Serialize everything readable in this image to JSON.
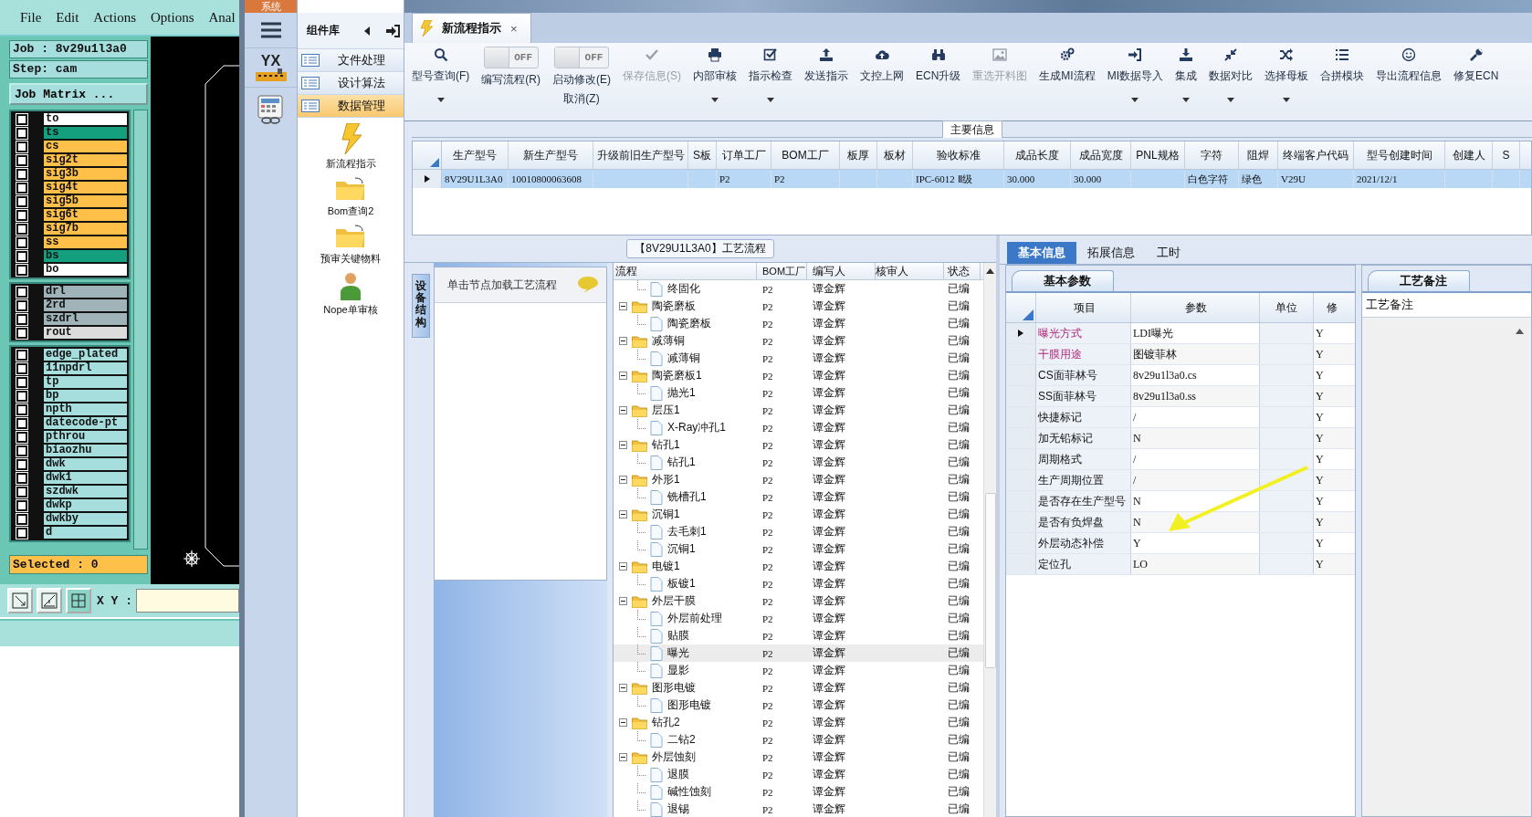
{
  "cam": {
    "menu": [
      "File",
      "Edit",
      "Actions",
      "Options",
      "Anal"
    ],
    "job": "Job : 8v29u1l3a0",
    "step": "Step: cam",
    "matrix_button": "Job Matrix ...",
    "layer_groups": [
      {
        "layers": [
          {
            "name": "to",
            "color": "#ffffff",
            "checked": false
          },
          {
            "name": "ts",
            "color": "#14a07e",
            "checked": false
          },
          {
            "name": "cs",
            "color": "#ffc04a",
            "checked": false
          },
          {
            "name": "sig2t",
            "color": "#ffc04a",
            "checked": false
          },
          {
            "name": "sig3b",
            "color": "#ffc04a",
            "checked": false
          },
          {
            "name": "sig4t",
            "color": "#ffc04a",
            "checked": false
          },
          {
            "name": "sig5b",
            "color": "#ffc04a",
            "checked": false
          },
          {
            "name": "sig6t",
            "color": "#ffc04a",
            "checked": false
          },
          {
            "name": "sig7b",
            "color": "#ffc04a",
            "checked": false
          },
          {
            "name": "ss",
            "color": "#ffc04a",
            "checked": false
          },
          {
            "name": "bs",
            "color": "#14a07e",
            "checked": false
          },
          {
            "name": "bo",
            "color": "#ffffff",
            "checked": false
          }
        ]
      },
      {
        "layers": [
          {
            "name": "drl",
            "color": "#9fb3b8",
            "checked": false
          },
          {
            "name": "2rd",
            "color": "#9fb3b8",
            "checked": false
          },
          {
            "name": "szdrl",
            "color": "#9fb3b8",
            "checked": false
          },
          {
            "name": "rout",
            "color": "#dcdcdc",
            "checked": false
          }
        ]
      },
      {
        "layers": [
          {
            "name": "edge_plated",
            "color": "#a6dede",
            "checked": false
          },
          {
            "name": "11npdrl",
            "color": "#a6dede",
            "checked": false
          },
          {
            "name": "tp",
            "color": "#a6dede",
            "checked": false
          },
          {
            "name": "bp",
            "color": "#a6dede",
            "checked": false
          },
          {
            "name": "npth",
            "color": "#a6dede",
            "checked": false
          },
          {
            "name": "datecode-pt",
            "color": "#a6dede",
            "checked": false
          },
          {
            "name": "pthrou",
            "color": "#a6dede",
            "checked": false
          },
          {
            "name": "biaozhu",
            "color": "#a6dede",
            "checked": false
          },
          {
            "name": "dwk",
            "color": "#a6dede",
            "checked": false
          },
          {
            "name": "dwk1",
            "color": "#a6dede",
            "checked": false
          },
          {
            "name": "szdwk",
            "color": "#a6dede",
            "checked": false
          },
          {
            "name": "dwkp",
            "color": "#a6dede",
            "checked": false
          },
          {
            "name": "dwkby",
            "color": "#a6dede",
            "checked": false
          },
          {
            "name": "d",
            "color": "#a6dede",
            "checked": false
          }
        ]
      }
    ],
    "selected_text": "Selected : 0",
    "xy_label": "X Y :"
  },
  "side_nav": {
    "system_tab": "系统",
    "logo": "YX"
  },
  "library": {
    "title": "组件库",
    "items": [
      {
        "label": "文件处理",
        "selected": false
      },
      {
        "label": "设计算法",
        "selected": false
      },
      {
        "label": "数据管理",
        "selected": true
      }
    ],
    "tools": [
      "新流程指示",
      "Bom查询2",
      "预审关键物料",
      "Nope单审核"
    ]
  },
  "doc_tab": {
    "label": "新流程指示",
    "close": "×"
  },
  "toolbar": [
    {
      "kind": "button",
      "label": "型号查询(F)",
      "dropdown": true,
      "disabled": false
    },
    {
      "kind": "toggle",
      "label": "编写流程(R)",
      "on": false,
      "state_text": "OFF"
    },
    {
      "kind": "toggle",
      "label": "启动修改(E)",
      "sublabel": "取消(Z)",
      "on": false,
      "state_text": "OFF"
    },
    {
      "kind": "button",
      "label": "保存信息(S)",
      "dropdown": false,
      "disabled": true
    },
    {
      "kind": "button",
      "label": "内部审核",
      "dropdown": true,
      "disabled": false
    },
    {
      "kind": "button",
      "label": "指示检查",
      "dropdown": true,
      "disabled": false
    },
    {
      "kind": "button",
      "label": "发送指示",
      "dropdown": false,
      "disabled": false
    },
    {
      "kind": "button",
      "label": "文控上网",
      "dropdown": false,
      "disabled": false
    },
    {
      "kind": "button",
      "label": "ECN升级",
      "dropdown": false,
      "disabled": false
    },
    {
      "kind": "button",
      "label": "重选开料图",
      "dropdown": false,
      "disabled": true
    },
    {
      "kind": "button",
      "label": "生成MI流程",
      "dropdown": false,
      "disabled": false
    },
    {
      "kind": "button",
      "label": "MI数据导入",
      "dropdown": true,
      "disabled": false
    },
    {
      "kind": "button",
      "label": "集成",
      "dropdown": true,
      "disabled": false
    },
    {
      "kind": "button",
      "label": "数据对比",
      "dropdown": true,
      "disabled": false
    },
    {
      "kind": "button",
      "label": "选择母板",
      "dropdown": true,
      "disabled": false
    },
    {
      "kind": "button",
      "label": "合拼模块",
      "dropdown": false,
      "disabled": false
    },
    {
      "kind": "button",
      "label": "导出流程信息",
      "dropdown": false,
      "disabled": false
    },
    {
      "kind": "button",
      "label": "修复ECN",
      "dropdown": false,
      "disabled": false
    }
  ],
  "main_info": {
    "title": "主要信息",
    "columns": [
      "生产型号",
      "新生产型号",
      "升级前旧生产型号",
      "S板",
      "订单工厂",
      "BOM工厂",
      "板厚",
      "板材",
      "验收标准",
      "成品长度",
      "成品宽度",
      "PNL规格",
      "字符",
      "阻焊",
      "终端客户代码",
      "型号创建时间",
      "创建人",
      "S"
    ],
    "rows": [
      {
        "selected": true,
        "cells": [
          "8V29U1L3A0",
          "10010800063608",
          null,
          null,
          "P2",
          "P2",
          null,
          null,
          "IPC-6012 Ⅱ级",
          "30.000",
          "30.000",
          null,
          "白色字符",
          "绿色",
          "V29U",
          "2021/12/1",
          null,
          null
        ]
      }
    ]
  },
  "flow": {
    "title": "【8V29U1L3A0】工艺流程",
    "side_tab": "设备结构",
    "hint": "单击节点加载工艺流程",
    "columns": [
      "流程",
      "BOM工厂",
      "编写人",
      "核审人",
      "状态"
    ],
    "nodes": [
      {
        "children": [
          {
            "label": "终固化",
            "bom": "P2",
            "writer": "谭金辉",
            "status": "已编",
            "selected": false
          }
        ]
      },
      {
        "label": "陶瓷磨板",
        "bom": "P2",
        "writer": "谭金辉",
        "status": "已编",
        "selected": false,
        "expanded": true,
        "children": [
          {
            "label": "陶瓷磨板",
            "bom": "P2",
            "writer": "谭金辉",
            "status": "已编",
            "selected": false
          }
        ]
      },
      {
        "label": "减薄铜",
        "bom": "P2",
        "writer": "谭金辉",
        "status": "已编",
        "selected": false,
        "expanded": true,
        "children": [
          {
            "label": "减薄铜",
            "bom": "P2",
            "writer": "谭金辉",
            "status": "已编",
            "selected": false
          }
        ]
      },
      {
        "label": "陶瓷磨板1",
        "bom": "P2",
        "writer": "谭金辉",
        "status": "已编",
        "selected": false,
        "expanded": true,
        "children": [
          {
            "label": "抛光1",
            "bom": "P2",
            "writer": "谭金辉",
            "status": "已编",
            "selected": false
          }
        ]
      },
      {
        "label": "层压1",
        "bom": "P2",
        "writer": "谭金辉",
        "status": "已编",
        "selected": false,
        "expanded": true,
        "children": [
          {
            "label": "X-Ray冲孔1",
            "bom": "P2",
            "writer": "谭金辉",
            "status": "已编",
            "selected": false
          }
        ]
      },
      {
        "label": "钻孔1",
        "bom": "P2",
        "writer": "谭金辉",
        "status": "已编",
        "selected": false,
        "expanded": true,
        "children": [
          {
            "label": "钻孔1",
            "bom": "P2",
            "writer": "谭金辉",
            "status": "已编",
            "selected": false
          }
        ]
      },
      {
        "label": "外形1",
        "bom": "P2",
        "writer": "谭金辉",
        "status": "已编",
        "selected": false,
        "expanded": true,
        "children": [
          {
            "label": "铣槽孔1",
            "bom": "P2",
            "writer": "谭金辉",
            "status": "已编",
            "selected": false
          }
        ]
      },
      {
        "label": "沉铜1",
        "bom": "P2",
        "writer": "谭金辉",
        "status": "已编",
        "selected": false,
        "expanded": true,
        "children": [
          {
            "label": "去毛刺1",
            "bom": "P2",
            "writer": "谭金辉",
            "status": "已编",
            "selected": false
          },
          {
            "label": "沉铜1",
            "bom": "P2",
            "writer": "谭金辉",
            "status": "已编",
            "selected": false
          }
        ]
      },
      {
        "label": "电镀1",
        "bom": "P2",
        "writer": "谭金辉",
        "status": "已编",
        "selected": false,
        "expanded": true,
        "children": [
          {
            "label": "板镀1",
            "bom": "P2",
            "writer": "谭金辉",
            "status": "已编",
            "selected": false
          }
        ]
      },
      {
        "label": "外层干膜",
        "bom": "P2",
        "writer": "谭金辉",
        "status": "已编",
        "selected": false,
        "expanded": true,
        "children": [
          {
            "label": "外层前处理",
            "bom": "P2",
            "writer": "谭金辉",
            "status": "已编",
            "selected": false
          },
          {
            "label": "贴膜",
            "bom": "P2",
            "writer": "谭金辉",
            "status": "已编",
            "selected": false
          },
          {
            "label": "曝光",
            "bom": "P2",
            "writer": "谭金辉",
            "status": "已编",
            "selected": true
          },
          {
            "label": "显影",
            "bom": "P2",
            "writer": "谭金辉",
            "status": "已编",
            "selected": false
          }
        ]
      },
      {
        "label": "图形电镀",
        "bom": "P2",
        "writer": "谭金辉",
        "status": "已编",
        "selected": false,
        "expanded": true,
        "children": [
          {
            "label": "图形电镀",
            "bom": "P2",
            "writer": "谭金辉",
            "status": "已编",
            "selected": false
          }
        ]
      },
      {
        "label": "钻孔2",
        "bom": "P2",
        "writer": "谭金辉",
        "status": "已编",
        "selected": false,
        "expanded": true,
        "children": [
          {
            "label": "二钻2",
            "bom": "P2",
            "writer": "谭金辉",
            "status": "已编",
            "selected": false
          }
        ]
      },
      {
        "label": "外层蚀刻",
        "bom": "P2",
        "writer": "谭金辉",
        "status": "已编",
        "selected": false,
        "expanded": true,
        "children": [
          {
            "label": "退膜",
            "bom": "P2",
            "writer": "谭金辉",
            "status": "已编",
            "selected": false
          },
          {
            "label": "碱性蚀刻",
            "bom": "P2",
            "writer": "谭金辉",
            "status": "已编",
            "selected": false
          },
          {
            "label": "退锡",
            "bom": "P2",
            "writer": "谭金辉",
            "status": "已编",
            "selected": false
          }
        ]
      }
    ]
  },
  "detail": {
    "tabs": [
      {
        "label": "基本信息",
        "selected": true
      },
      {
        "label": "拓展信息",
        "selected": false
      },
      {
        "label": "工时",
        "selected": false
      }
    ],
    "params": {
      "title": "基本参数",
      "columns": [
        "项目",
        "参数",
        "单位",
        "修"
      ],
      "rows": [
        {
          "item": "曝光方式",
          "value": "LDI曝光",
          "modify": "Y",
          "highlighted": true,
          "selected": true
        },
        {
          "item": "干膜用途",
          "value": "图镀菲林",
          "modify": "Y",
          "highlighted": true,
          "selected": false
        },
        {
          "item": "CS面菲林号",
          "value": "8v29u1l3a0.cs",
          "modify": "Y",
          "highlighted": false,
          "selected": false
        },
        {
          "item": "SS面菲林号",
          "value": "8v29u1l3a0.ss",
          "modify": "Y",
          "highlighted": false,
          "selected": false
        },
        {
          "item": "快捷标记",
          "value": "/",
          "modify": "Y",
          "highlighted": false,
          "selected": false
        },
        {
          "item": "加无铅标记",
          "value": "N",
          "modify": "Y",
          "highlighted": false,
          "selected": false
        },
        {
          "item": "周期格式",
          "value": "/",
          "modify": "Y",
          "highlighted": false,
          "selected": false
        },
        {
          "item": "生产周期位置",
          "value": "/",
          "modify": "Y",
          "highlighted": false,
          "selected": false
        },
        {
          "item": "是否存在生产型号",
          "value": "N",
          "modify": "Y",
          "highlighted": false,
          "selected": false
        },
        {
          "item": "是否有负焊盘",
          "value": "N",
          "modify": "Y",
          "highlighted": false,
          "selected": false
        },
        {
          "item": "外层动态补偿",
          "value": "Y",
          "modify": "Y",
          "highlighted": false,
          "selected": false
        },
        {
          "item": "定位孔",
          "value": "LO",
          "modify": "Y",
          "highlighted": false,
          "selected": false
        }
      ]
    },
    "notes": {
      "title": "工艺备注",
      "column": "工艺备注"
    }
  }
}
